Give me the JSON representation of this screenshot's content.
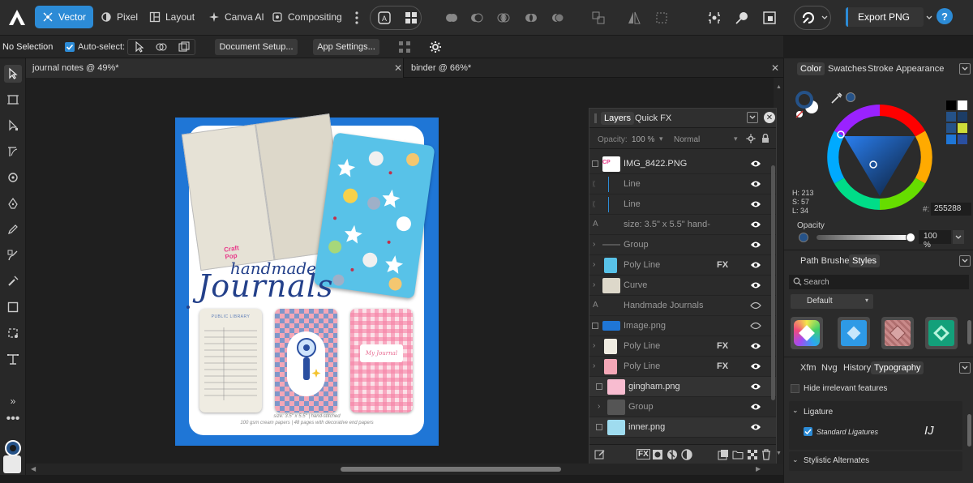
{
  "toolbar": {
    "personas": [
      "Vector",
      "Pixel",
      "Layout",
      "Canva AI",
      "Compositing"
    ],
    "export_label": "Export PNG",
    "help": "?"
  },
  "context": {
    "selection": "No Selection",
    "auto_select": "Auto-select:",
    "document_setup": "Document Setup...",
    "app_settings": "App Settings..."
  },
  "tabs": [
    "journal notes @ 49%*",
    "binder @ 66%*"
  ],
  "document": {
    "title_small": "handmade",
    "title_large": "Journals",
    "caption_line1": "size: 3.5\" x 5.5\" | hand-stitched",
    "caption_line2": "100 gsm cream papers | 48 pages with decorative end papers",
    "logo_text": "Craft Pop",
    "library_card": "PUBLIC LIBRARY",
    "journal_label": "My Journal"
  },
  "layers_panel": {
    "tabs": [
      "Layers",
      "Quick FX"
    ],
    "opacity_label": "Opacity:",
    "opacity_value": "100 %",
    "blend_mode": "Normal",
    "rows": [
      {
        "name": "IMG_8422.PNG",
        "fx": "",
        "eye": "visible"
      },
      {
        "name": "Line",
        "fx": "",
        "eye": "visible"
      },
      {
        "name": "Line",
        "fx": "",
        "eye": "visible"
      },
      {
        "name": "size: 3.5\" x 5.5\"   hand-",
        "fx": "",
        "eye": "visible"
      },
      {
        "name": "Group",
        "fx": "",
        "eye": "visible"
      },
      {
        "name": "Poly Line",
        "fx": "FX",
        "eye": "visible"
      },
      {
        "name": "Curve",
        "fx": "",
        "eye": "visible"
      },
      {
        "name": "Handmade Journals",
        "fx": "",
        "eye": "hidden"
      },
      {
        "name": "Image.png",
        "fx": "",
        "eye": "hidden"
      },
      {
        "name": "Poly Line",
        "fx": "FX",
        "eye": "visible"
      },
      {
        "name": "Poly Line",
        "fx": "FX",
        "eye": "visible"
      },
      {
        "name": "gingham.png",
        "fx": "",
        "eye": "visible"
      },
      {
        "name": "Group",
        "fx": "",
        "eye": "visible"
      },
      {
        "name": "inner.png",
        "fx": "",
        "eye": "visible"
      }
    ],
    "footer_fx": "FX"
  },
  "color_panel": {
    "tabs": [
      "Color",
      "Swatches",
      "Stroke",
      "Appearance"
    ],
    "h": "H: 213",
    "s": "S: 57",
    "l": "L: 34",
    "hex_label": "#:",
    "hex": "255288",
    "opacity_label": "Opacity",
    "opacity_value": "100 %",
    "primary_color": "#255288"
  },
  "styles_panel": {
    "tabs": [
      "Path Brushes",
      "Styles"
    ],
    "search_placeholder": "Search",
    "category": "Default"
  },
  "typo_panel": {
    "tabs": [
      "Xfm",
      "Nvg",
      "History",
      "Typography"
    ],
    "hide_irrelevant": "Hide irrelevant features",
    "ligature_header": "Ligature",
    "standard_ligatures": "Standard Ligatures",
    "ligature_sample": "IJ",
    "stylistic_header": "Stylistic Alternates"
  }
}
